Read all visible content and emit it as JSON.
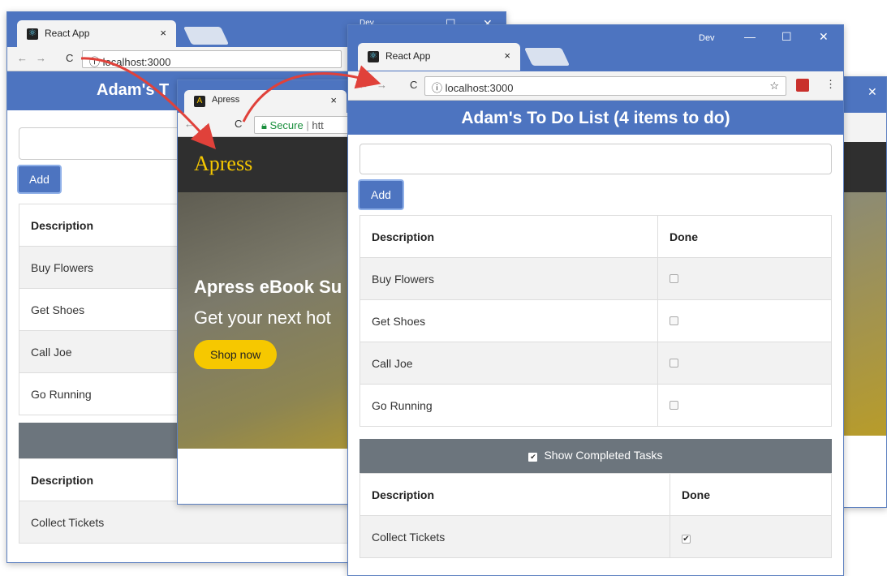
{
  "back_window": {
    "tab_title": "React App",
    "address": "localhost:3000",
    "caption_profile": "Dev",
    "header_title": "Adam's T",
    "add_label": "Add",
    "table_header": "Description",
    "items": [
      "Buy Flowers",
      "Get Shoes",
      "Call Joe",
      "Go Running"
    ],
    "completed_header": "Description",
    "completed_items": [
      "Collect Tickets"
    ]
  },
  "apress_window": {
    "tab_title": "Apress",
    "secure_label": "Secure",
    "url_fragment": "htt",
    "logo": "Apress",
    "hero_title": "Apress eBook Su",
    "hero_subtitle": "Get your next hot",
    "shop_button": "Shop now"
  },
  "front_window": {
    "tab_title": "React App",
    "profile": "Dev",
    "address": "localhost:3000",
    "header_title": "Adam's To Do List (4 items to do)",
    "add_label": "Add",
    "input_value": "",
    "columns": [
      "Description",
      "Done"
    ],
    "items": [
      {
        "description": "Buy Flowers",
        "done": false
      },
      {
        "description": "Get Shoes",
        "done": false
      },
      {
        "description": "Call Joe",
        "done": false
      },
      {
        "description": "Go Running",
        "done": false
      }
    ],
    "toggle_label": "Show Completed Tasks",
    "toggle_checked": true,
    "completed_columns": [
      "Description",
      "Done"
    ],
    "completed_items": [
      {
        "description": "Collect Tickets",
        "done": true
      }
    ]
  },
  "colors": {
    "chrome": "#4d74c0",
    "arrow": "#e0413a",
    "toggle_bar": "#6c757d",
    "apress_yellow": "#f6c800"
  }
}
